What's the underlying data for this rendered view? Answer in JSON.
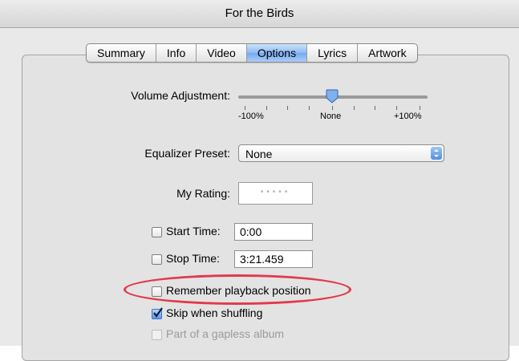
{
  "window": {
    "title": "For the Birds"
  },
  "tabs": [
    {
      "label": "Summary",
      "active": false
    },
    {
      "label": "Info",
      "active": false
    },
    {
      "label": "Video",
      "active": false
    },
    {
      "label": "Options",
      "active": true
    },
    {
      "label": "Lyrics",
      "active": false
    },
    {
      "label": "Artwork",
      "active": false
    }
  ],
  "volume": {
    "label": "Volume Adjustment:",
    "min_label": "-100%",
    "mid_label": "None",
    "max_label": "+100%",
    "value_percent": 0
  },
  "equalizer": {
    "label": "Equalizer Preset:",
    "value": "None"
  },
  "rating": {
    "label": "My Rating:",
    "stars": 0
  },
  "start_time": {
    "label": "Start Time:",
    "value": "0:00",
    "checked": false
  },
  "stop_time": {
    "label": "Stop Time:",
    "value": "3:21.459",
    "checked": false
  },
  "options": {
    "remember_label": "Remember playback position",
    "remember_checked": false,
    "skip_label": "Skip when shuffling",
    "skip_checked": true,
    "gapless_label": "Part of a gapless album",
    "gapless_checked": false,
    "gapless_disabled": true
  },
  "colors": {
    "accent": "#76a9ee",
    "annotation": "#e23a4a"
  }
}
